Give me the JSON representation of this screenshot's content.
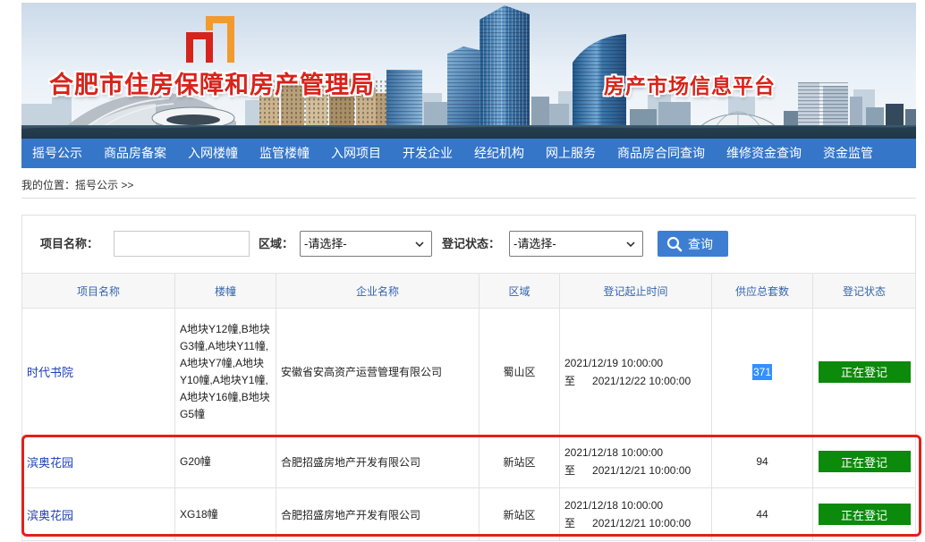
{
  "colors": {
    "nav_bg": "#3576c9",
    "title_red": "#d8231b",
    "header_text": "#3566b0",
    "link_blue": "#1f3fba",
    "status_green": "#0b8a0b",
    "button_blue": "#3d7ed3",
    "annotation_red": "#e3201b",
    "selection_blue": "#3390ff"
  },
  "header": {
    "title": "合肥市住房保障和房产管理局",
    "subtitle": "房产市场信息平台",
    "logo_icon": "housing-bureau-logo-icon"
  },
  "nav": {
    "items": [
      "摇号公示",
      "商品房备案",
      "入网楼幢",
      "监管楼幢",
      "入网项目",
      "开发企业",
      "经纪机构",
      "网上服务",
      "商品房合同查询",
      "维修资金查询",
      "资金监管"
    ]
  },
  "breadcrumb": {
    "prefix": "我的位置：",
    "current": "摇号公示",
    "separator": ">>"
  },
  "search": {
    "project_label": "项目名称：",
    "project_value": "",
    "district_label": "区域：",
    "district_selected": "-请选择-",
    "status_label": "登记状态：",
    "status_selected": "-请选择-",
    "select_icon": "chevron-down-icon",
    "button_label": "查询",
    "button_icon": "search-icon"
  },
  "table": {
    "columns": [
      "项目名称",
      "楼幢",
      "企业名称",
      "区域",
      "登记起止时间",
      "供应总套数",
      "登记状态"
    ],
    "period_separator": "至",
    "rows": [
      {
        "project": "时代书院",
        "buildings": "A地块Y12幢,B地块G3幢,A地块Y11幢,A地块Y7幢,A地块Y10幢,A地块Y1幢,A地块Y16幢,B地块G5幢",
        "company": "安徽省安高资产运营管理有限公司",
        "district": "蜀山区",
        "start": "2021/12/19 10:00:00",
        "end": "2021/12/22 10:00:00",
        "units": 371,
        "status": "正在登记"
      },
      {
        "project": "滨奥花园",
        "buildings": "G20幢",
        "company": "合肥招盛房地产开发有限公司",
        "district": "新站区",
        "start": "2021/12/18 10:00:00",
        "end": "2021/12/21 10:00:00",
        "units": 94,
        "status": "正在登记"
      },
      {
        "project": "滨奥花园",
        "buildings": "XG18幢",
        "company": "合肥招盛房地产开发有限公司",
        "district": "新站区",
        "start": "2021/12/18 10:00:00",
        "end": "2021/12/21 10:00:00",
        "units": 44,
        "status": "正在登记"
      }
    ]
  }
}
